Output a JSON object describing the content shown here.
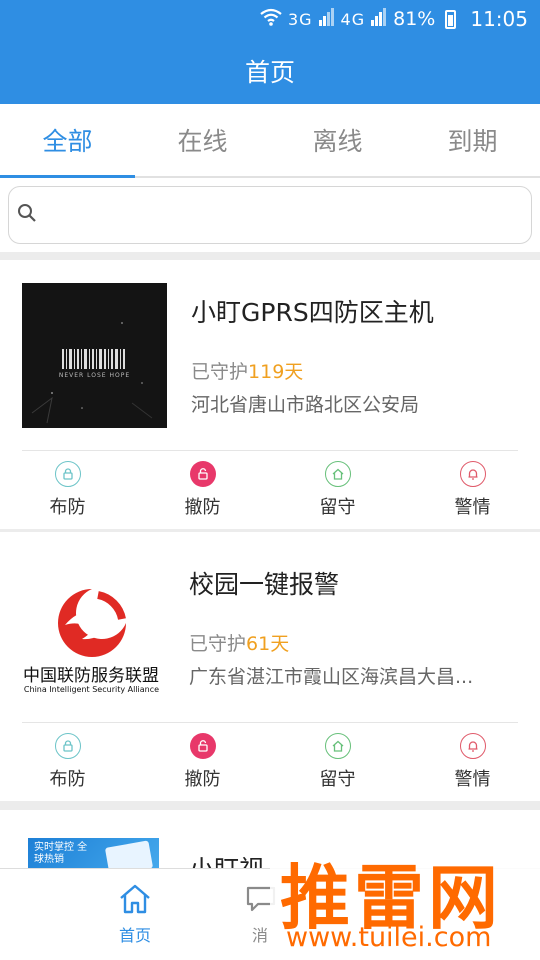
{
  "status_bar": {
    "network": "3G",
    "network2": "4G",
    "battery": "81%",
    "time": "11:05"
  },
  "title": "首页",
  "tabs": [
    {
      "label": "全部",
      "active": true
    },
    {
      "label": "在线",
      "active": false
    },
    {
      "label": "离线",
      "active": false
    },
    {
      "label": "到期",
      "active": false
    }
  ],
  "search": {
    "placeholder": ""
  },
  "devices": [
    {
      "name": "小盯GPRS四防区主机",
      "guard_prefix": "已守护",
      "guard_days": "119天",
      "address": "河北省唐山市路北区公安局",
      "thumb_text": "NEVER LOSE HOPE"
    },
    {
      "name": "校园一键报警",
      "guard_prefix": "已守护",
      "guard_days": "61天",
      "address": "广东省湛江市霞山区海滨昌大昌...",
      "thumb_text": "中国联防服务联盟",
      "thumb_subtext": "China Intelligent Security Alliance"
    },
    {
      "name": "小盯视",
      "thumb_text": "实时掌控 全球热销"
    }
  ],
  "actions": {
    "arm": "布防",
    "disarm": "撤防",
    "stay": "留守",
    "alarm": "警情"
  },
  "bottom_nav": [
    {
      "label": "首页",
      "icon": "home-icon",
      "active": true
    },
    {
      "label": "消",
      "icon": "message-icon",
      "active": false
    }
  ],
  "watermark": {
    "brand": "推雷网",
    "url": "www.tuilei.com"
  },
  "colors": {
    "primary": "#2f8ee3",
    "days": "#f0a020",
    "disarm": "#e8386a"
  }
}
